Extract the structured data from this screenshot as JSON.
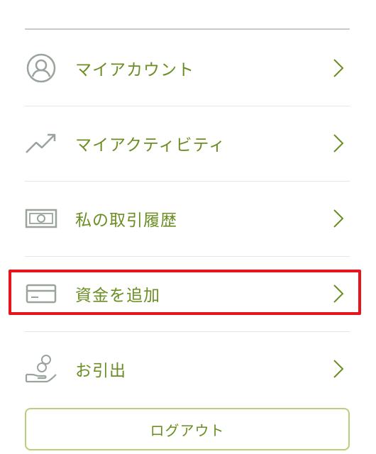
{
  "menu": {
    "items": [
      {
        "label": "マイアカウント",
        "icon": "user-account-icon"
      },
      {
        "label": "マイアクティビティ",
        "icon": "trend-chart-icon"
      },
      {
        "label": "私の取引履歴",
        "icon": "banknote-icon"
      },
      {
        "label": "資金を追加",
        "icon": "credit-card-icon"
      },
      {
        "label": "お引出",
        "icon": "hand-coins-icon"
      }
    ]
  },
  "logout": {
    "label": "ログアウト"
  },
  "colors": {
    "accent_text": "#6b8e23",
    "icon_gray": "#9aa39c",
    "highlight": "#e8141b",
    "border_green": "#b8cf7a"
  }
}
